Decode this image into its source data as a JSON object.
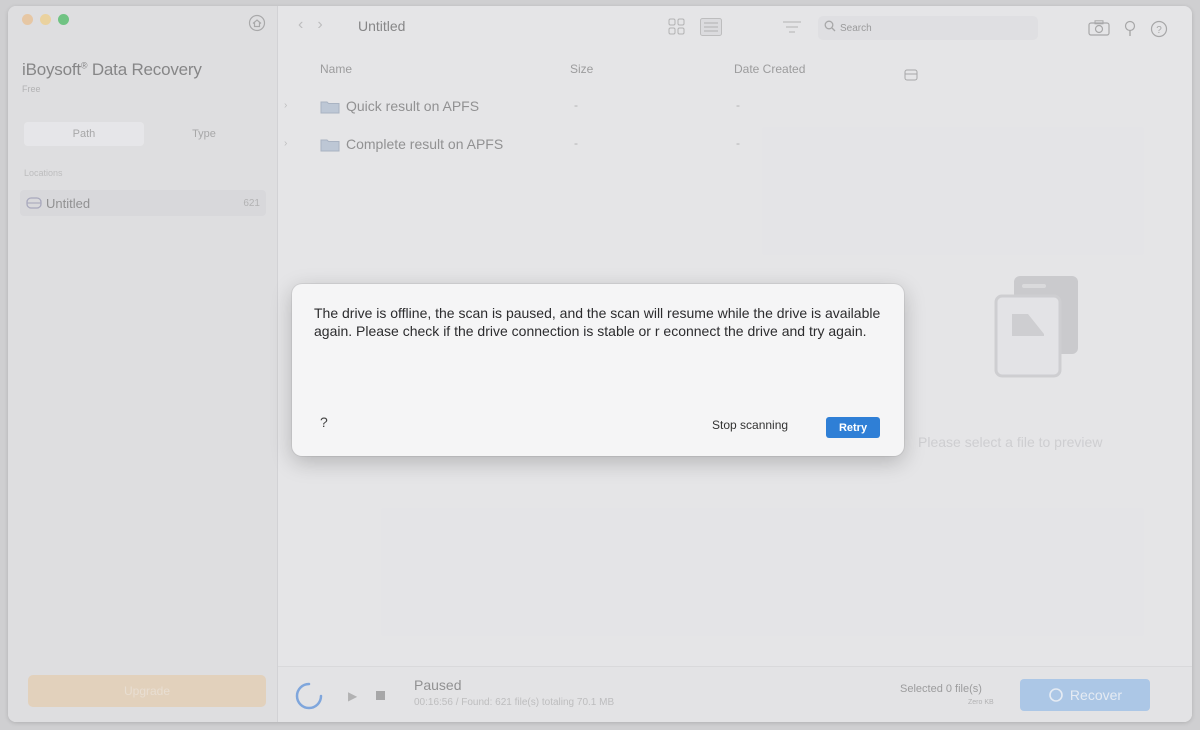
{
  "colors": {
    "close_dot": "#e9b882",
    "minimize_dot": "#efc97a",
    "maximize_dot": "#33b24f",
    "retry_button": "#2f7fd6",
    "recover_button": "#8fb8e6"
  },
  "sidebar": {
    "app_title": "iBoysoft",
    "app_title_mark": "®",
    "app_title_rest": " Data Recovery",
    "app_subtitle": "Free",
    "tabs": [
      {
        "label": "Path"
      },
      {
        "label": "Type"
      }
    ],
    "section_label": "Locations",
    "items": [
      {
        "label": "Untitled",
        "count": "621",
        "icon": "drive-icon"
      }
    ],
    "bottom_button_label": "Upgrade"
  },
  "toolbar": {
    "title": "Untitled",
    "search_placeholder": "Search",
    "icons": [
      "home-icon",
      "back-icon",
      "forward-icon",
      "grid-view-icon",
      "list-view-icon",
      "sort-icon",
      "search-icon",
      "camera-icon",
      "lightbulb-icon",
      "help-icon"
    ]
  },
  "filelist": {
    "columns": {
      "name": "Name",
      "size": "Size",
      "date": "Date Created"
    },
    "rows": [
      {
        "name": "Quick result on APFS",
        "size": "-",
        "date": "-"
      },
      {
        "name": "Complete result on APFS",
        "size": "-",
        "date": "-"
      }
    ]
  },
  "preview": {
    "placeholder": "Please select a file to preview"
  },
  "bottombar": {
    "status": "Paused",
    "status_detail": "00:16:56 / Found: 621 file(s) totaling 70.1 MB",
    "selected": "Selected 0 file(s)",
    "selected_size": "Zero KB",
    "recover_label": "Recover"
  },
  "dialog": {
    "message": "The drive is offline, the scan is paused, and the scan will resume while the drive is available again. Please check if the drive connection is stable or r econnect the drive and try again.",
    "help": "?",
    "stop_label": "Stop scanning",
    "retry_label": "Retry"
  }
}
